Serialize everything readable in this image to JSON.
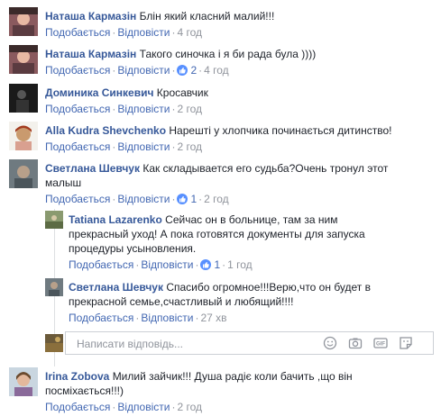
{
  "actions": {
    "like": "Подобається",
    "reply": "Відповісти"
  },
  "comments": [
    {
      "name": "Наташа Кармазін",
      "text": "Блін який класний малий!!!",
      "likes": "",
      "time": "4 год"
    },
    {
      "name": "Наташа Кармазін",
      "text": "Такого синочка і я би рада була ))))",
      "likes": "2",
      "time": "4 год"
    },
    {
      "name": "Доминика Синкевич",
      "text": "Кросавчик",
      "likes": "",
      "time": "2 год"
    },
    {
      "name": "Alla Kudra Shevchenko",
      "text": "Нарешті у хлопчика починається дитинство!",
      "likes": "",
      "time": "2 год"
    },
    {
      "name": "Светлана Шевчук",
      "text": "Как складывается его судьба?Очень тронул этот малыш",
      "likes": "1",
      "time": "2 год"
    },
    {
      "name": "Tatiana Lazarenko",
      "text": "Сейчас он в больнице, там за ним прекрасный уход! А пока готовятся документы для запуска процедуры усыновления.",
      "likes": "1",
      "time": "1 год"
    },
    {
      "name": "Светлана Шевчук",
      "text": "Спасибо огромное!!!Верю,что он будет в прекрасной семье,счастливый и любящий!!!!",
      "likes": "",
      "time": "27 хв"
    },
    {
      "name": "Irina Zobova",
      "text": "Милий зайчик!!! Душа радіє коли бачить ,що він посміхається!!!)",
      "likes": "",
      "time": "2 год"
    }
  ],
  "composer": {
    "placeholder": "Написати відповідь..."
  },
  "icons": {
    "like_bubble": "thumbs-up-icon",
    "emoji": "smiley-icon",
    "camera": "camera-icon",
    "gif": "gif-icon",
    "sticker": "sticker-icon"
  },
  "colors": {
    "name": "#365899",
    "link": "#4267b2",
    "meta": "#90949c",
    "like": "#5890ff"
  }
}
